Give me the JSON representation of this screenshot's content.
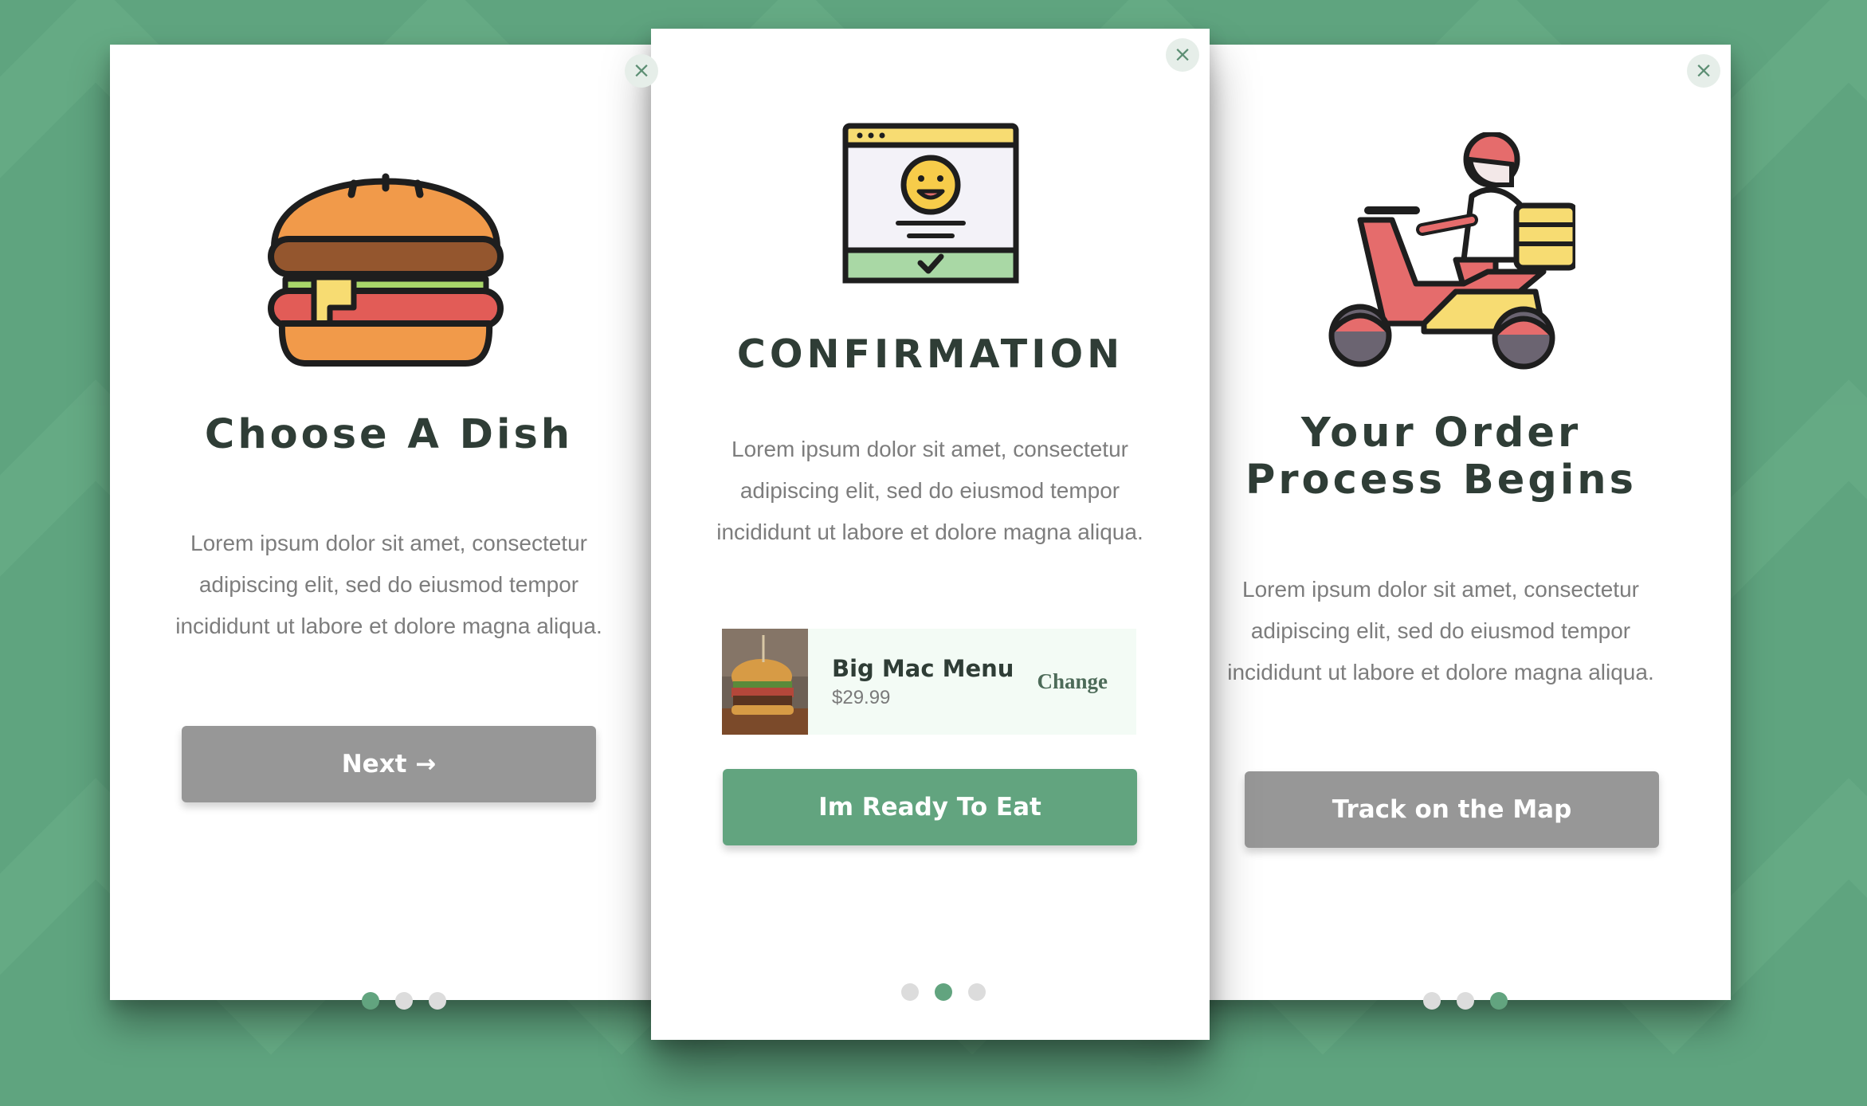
{
  "cards": [
    {
      "title": "Choose A Dish",
      "description": "Lorem ipsum dolor sit amet, consectetur adipiscing elit, sed do eiusmod tempor incididunt ut labore et dolore magna aliqua.",
      "button_label": "Next →",
      "close_label": "×",
      "illustration": "burger-icon",
      "active_step": 1,
      "total_steps": 3
    },
    {
      "title": "CONFIRMATION",
      "description": "Lorem ipsum dolor sit amet, consectetur adipiscing elit, sed do eiusmod tempor incididunt ut labore et dolore magna aliqua.",
      "button_label": "Im Ready To Eat",
      "close_label": "×",
      "illustration": "browser-smiley-check-icon",
      "active_step": 2,
      "total_steps": 3,
      "order": {
        "item_name": "Big Mac Menu",
        "price": "$29.99",
        "change_label": "Change",
        "thumbnail": "burger-photo"
      }
    },
    {
      "title_line1": "Your Order",
      "title_line2": "Process Begins",
      "description": "Lorem ipsum dolor sit amet, consectetur adipiscing elit, sed do eiusmod tempor incididunt ut labore et dolore magna aliqua.",
      "button_label": "Track on the Map",
      "close_label": "×",
      "illustration": "delivery-scooter-icon",
      "active_step": 3,
      "total_steps": 3
    }
  ],
  "colors": {
    "background": "#5fa47f",
    "accent": "#62a47f",
    "button_gray": "#979797",
    "title": "#2f3d36",
    "body_text": "#7d7d7d"
  }
}
